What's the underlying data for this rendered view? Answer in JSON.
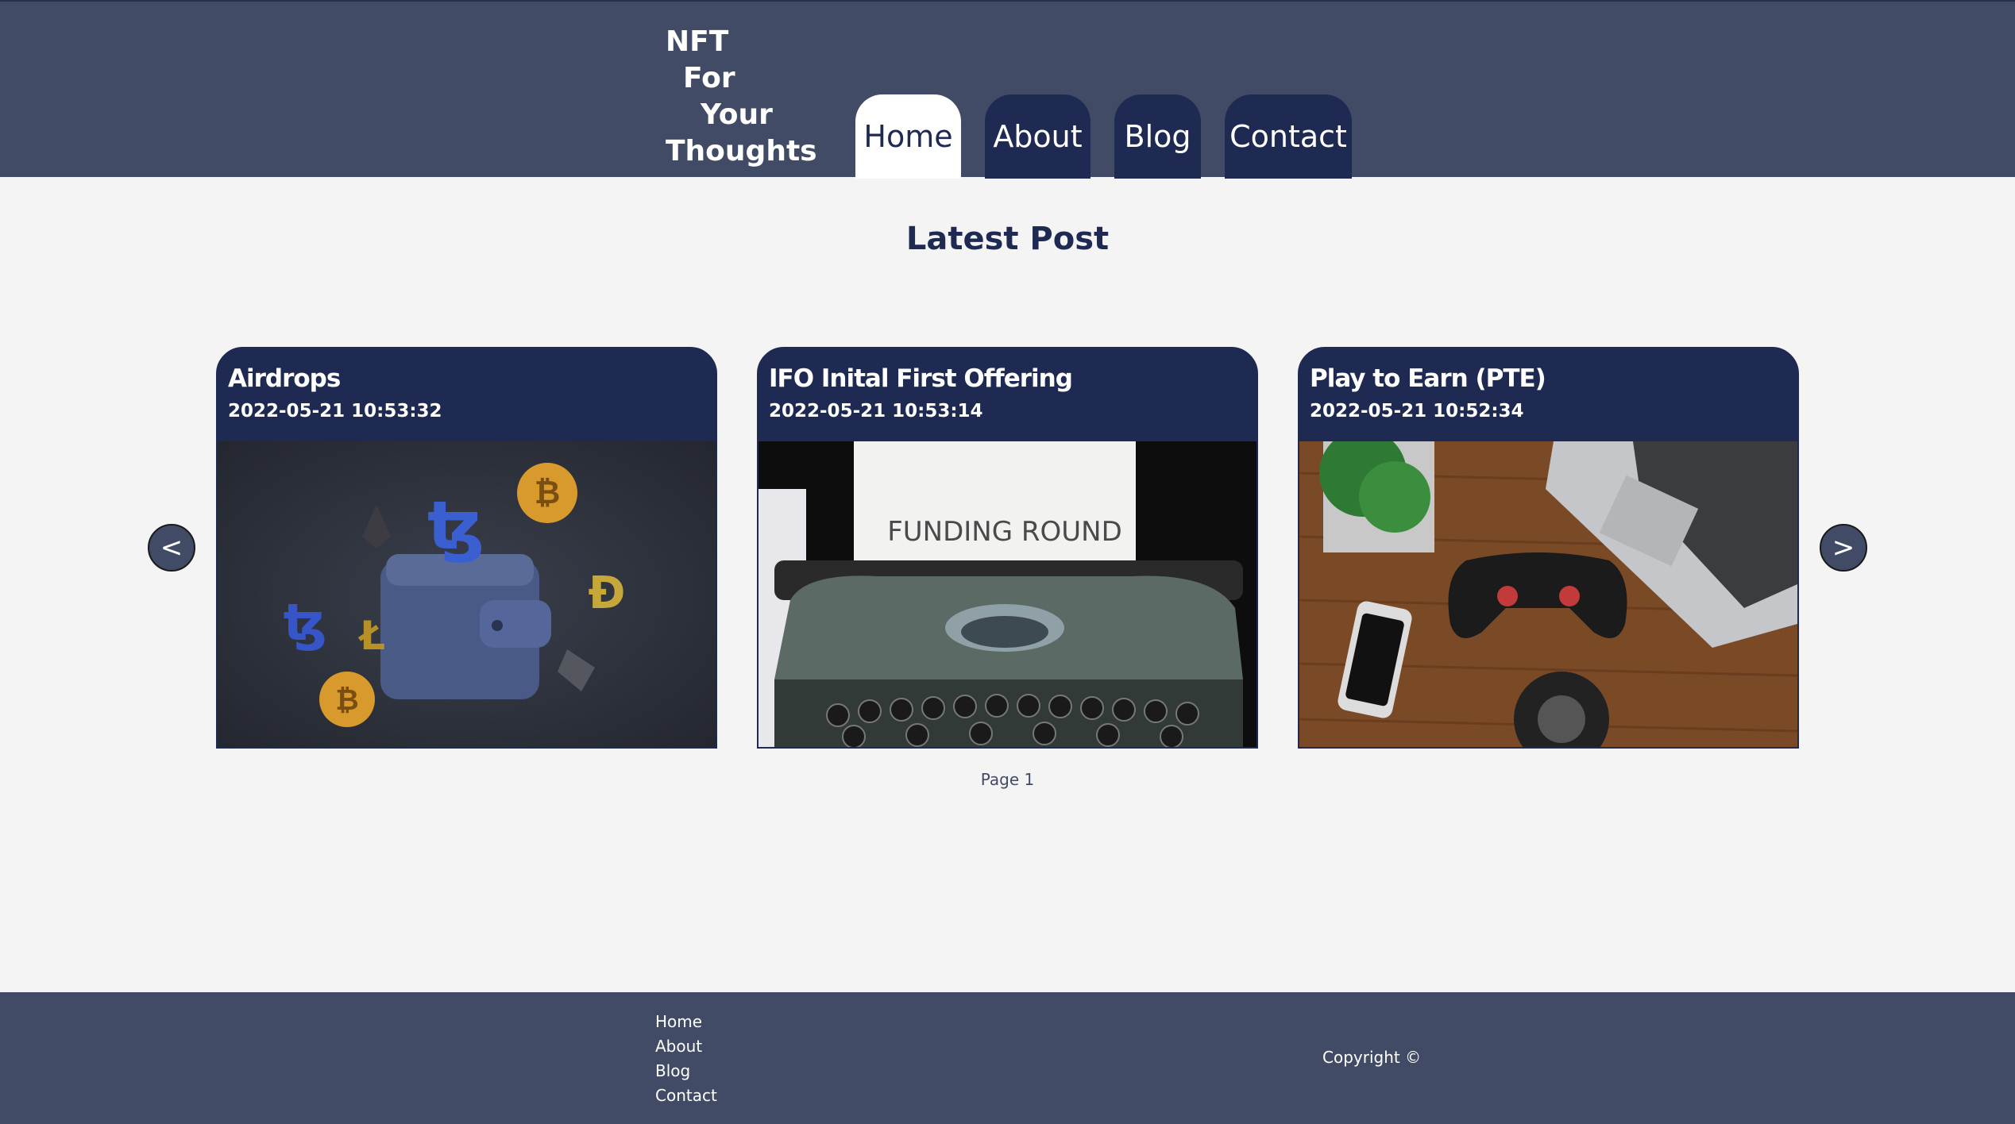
{
  "site": {
    "logo_lines": [
      "NFT",
      "For",
      "Your",
      "Thoughts"
    ]
  },
  "nav": {
    "tabs": [
      {
        "label": "Home",
        "active": true
      },
      {
        "label": "About",
        "active": false
      },
      {
        "label": "Blog",
        "active": false
      },
      {
        "label": "Contact",
        "active": false
      }
    ]
  },
  "main": {
    "section_title": "Latest Post",
    "prev_label": "<",
    "next_label": ">",
    "posts": [
      {
        "title": "Airdrops",
        "date": "2022-05-21 10:53:32",
        "image": "crypto-wallet-image"
      },
      {
        "title": "IFO Inital First Offering",
        "date": "2022-05-21 10:53:14",
        "image": "typewriter-funding-round-image",
        "image_text": "FUNDING ROUND"
      },
      {
        "title": "Play to Earn (PTE)",
        "date": "2022-05-21 10:52:34",
        "image": "gaming-desk-image"
      }
    ],
    "page_label": "Page 1"
  },
  "footer": {
    "links": [
      "Home",
      "About",
      "Blog",
      "Contact"
    ],
    "copyright": "Copyright ©"
  },
  "colors": {
    "header_bg": "#424b66",
    "accent_navy": "#1f2a52",
    "page_bg": "#f4f4f4"
  }
}
